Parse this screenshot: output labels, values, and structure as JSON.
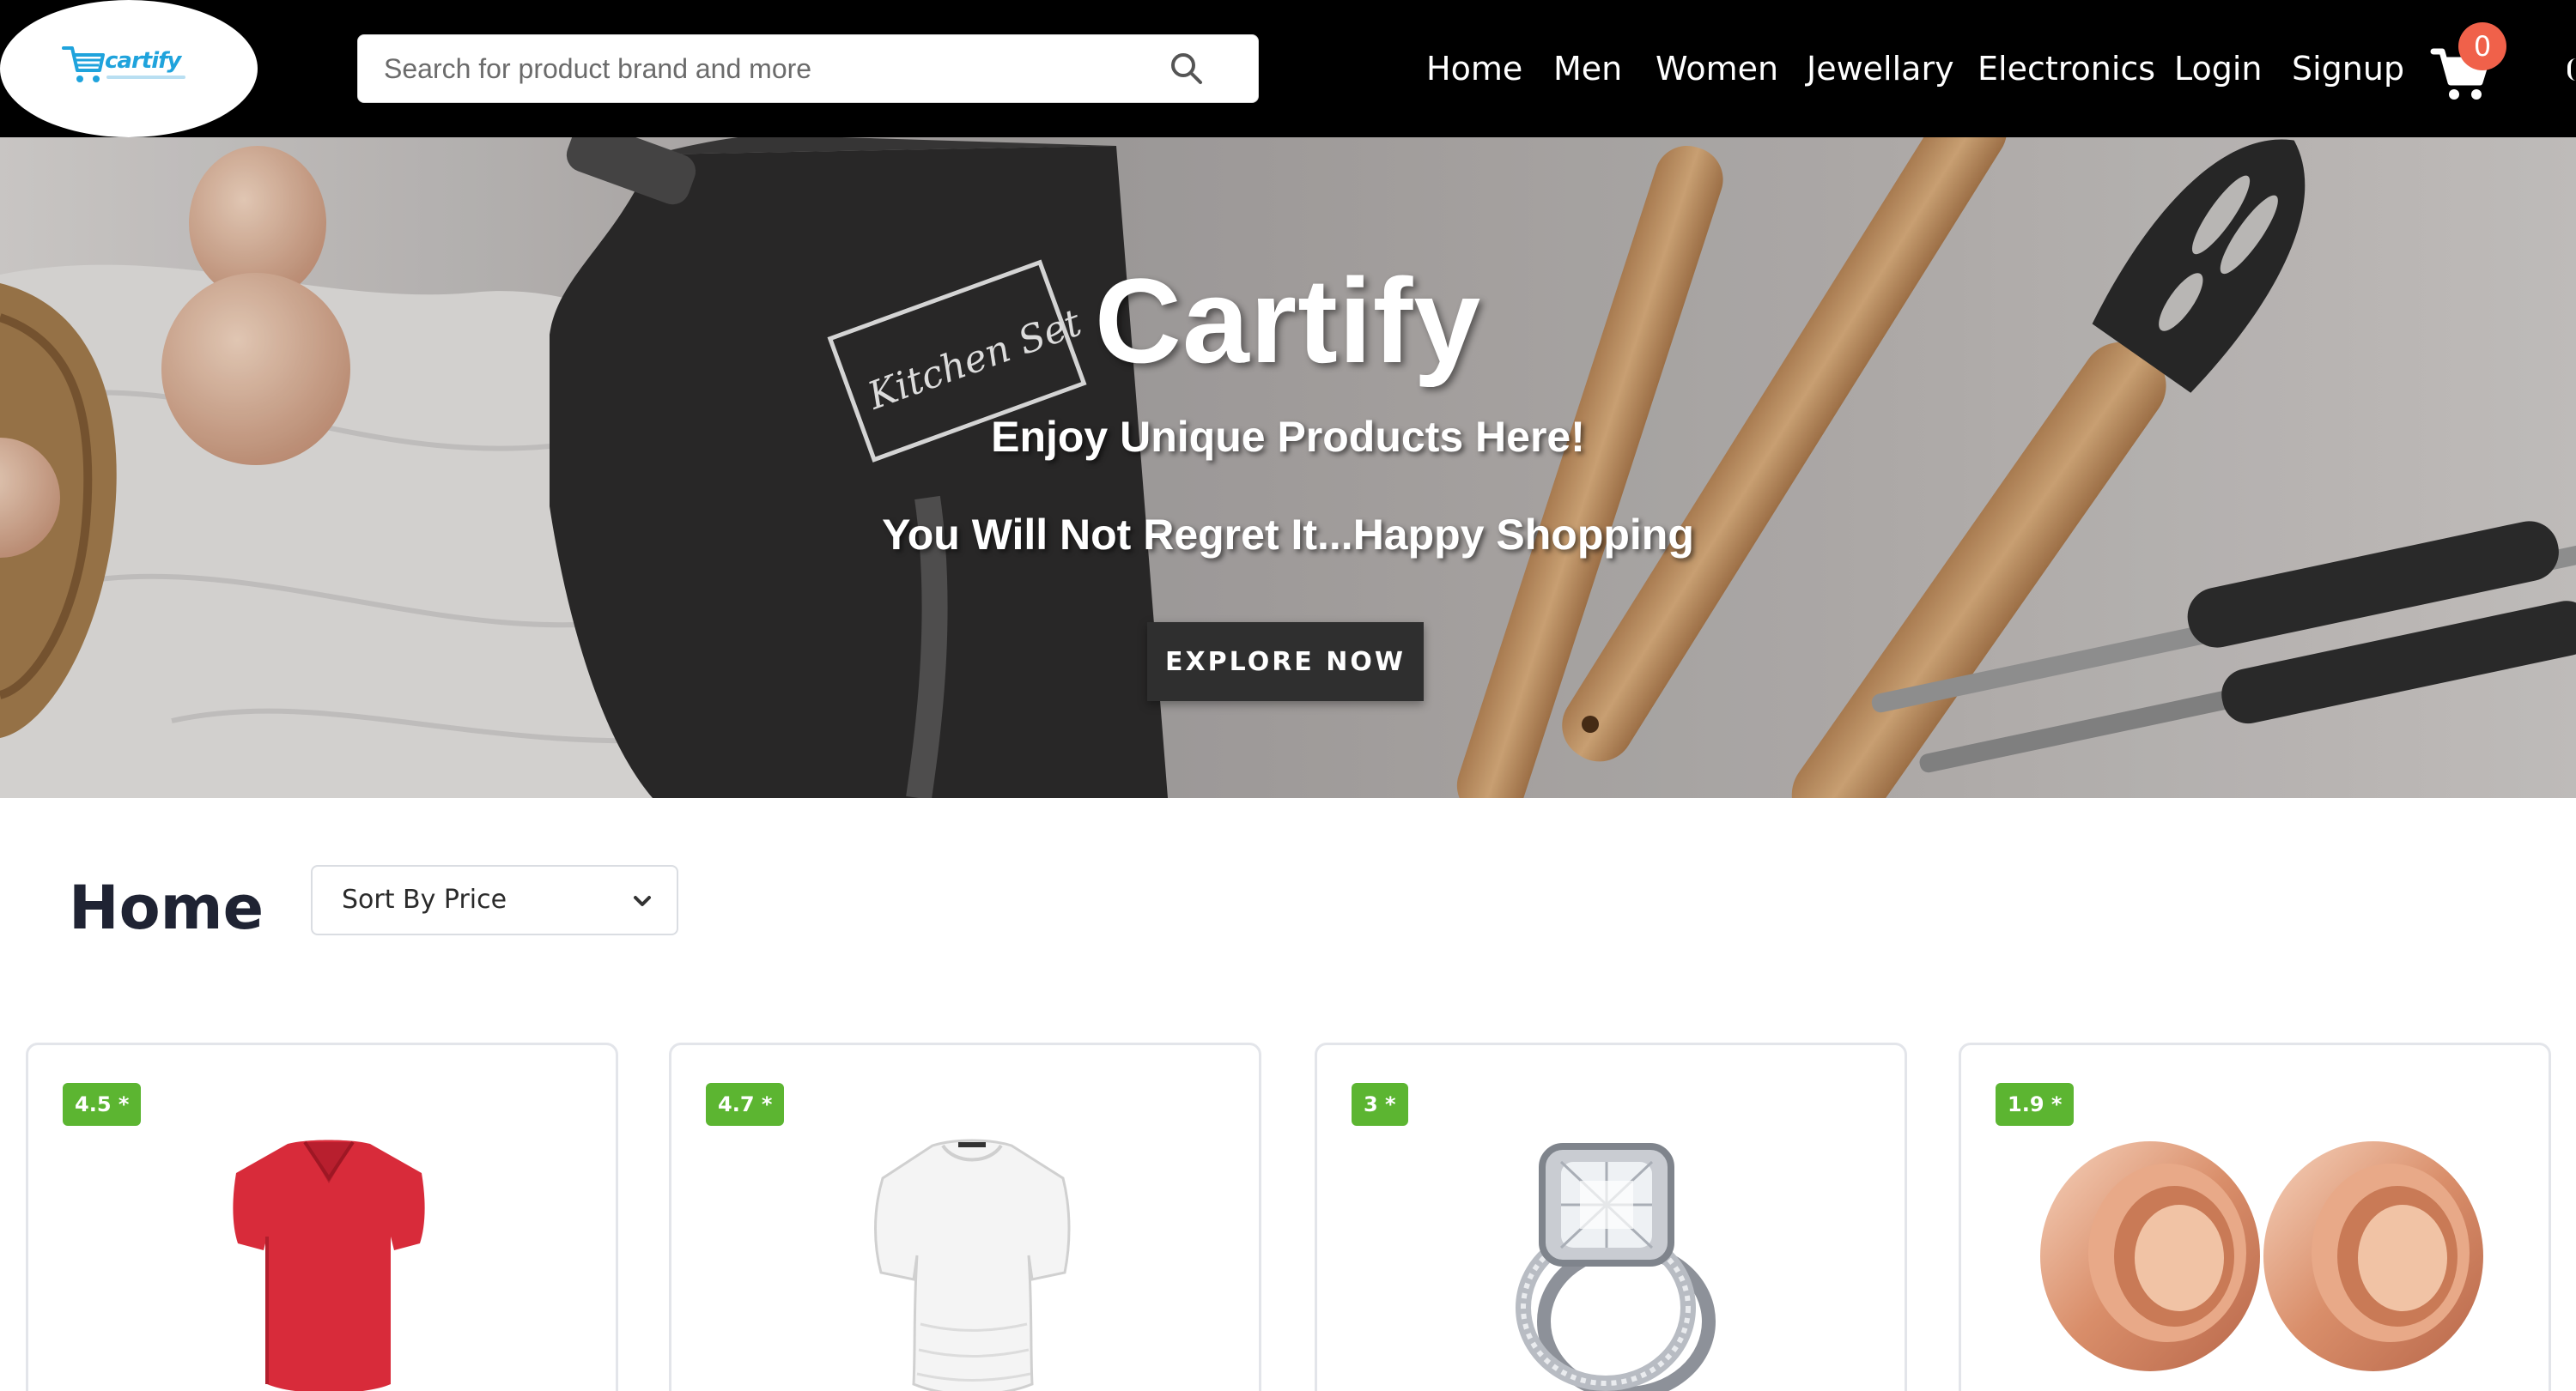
{
  "brand": {
    "logo_text": "cartify"
  },
  "search": {
    "placeholder": "Search for product brand and more"
  },
  "nav": {
    "items": [
      {
        "label": "Home"
      },
      {
        "label": "Men"
      },
      {
        "label": "Women"
      },
      {
        "label": "Jewellary"
      },
      {
        "label": "Electronics"
      },
      {
        "label": "Login"
      },
      {
        "label": "Signup"
      }
    ],
    "cart_count": "0"
  },
  "hero": {
    "title": "Cartify",
    "subtitle": "Enjoy Unique Products Here!",
    "tagline": "You Will Not Regret It...Happy Shopping",
    "cta_label": "EXPLORE NOW",
    "tin_label": "Kitchen Set"
  },
  "main": {
    "title": "Home",
    "sort_label": "Sort By Price"
  },
  "products": [
    {
      "rating": "4.5 *",
      "item": "red-tshirt"
    },
    {
      "rating": "4.7 *",
      "item": "white-top"
    },
    {
      "rating": "3 *",
      "item": "diamond-ring"
    },
    {
      "rating": "1.9 *",
      "item": "rose-gold-plugs"
    }
  ],
  "colors": {
    "navbar": "#000000",
    "cart_badge": "#f0614a",
    "rating_badge": "#5cb531",
    "logo": "#1fa3dc",
    "cta_button": "#2f2f2f"
  }
}
